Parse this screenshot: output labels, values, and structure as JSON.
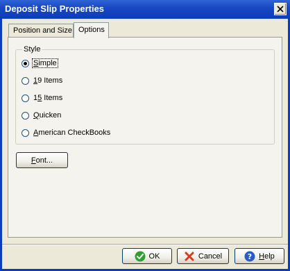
{
  "window": {
    "title": "Deposit Slip Properties"
  },
  "tabs": [
    {
      "label": "Position and Size"
    },
    {
      "label": "Options"
    }
  ],
  "style_group": {
    "legend": "Style",
    "options": [
      {
        "prefix": "",
        "accel": "S",
        "rest": "imple",
        "checked": true
      },
      {
        "prefix": "",
        "accel": "1",
        "rest": "9 Items",
        "checked": false
      },
      {
        "prefix": "1",
        "accel": "5",
        "rest": " Items",
        "checked": false
      },
      {
        "prefix": "",
        "accel": "Q",
        "rest": "uicken",
        "checked": false
      },
      {
        "prefix": "",
        "accel": "A",
        "rest": "merican CheckBooks",
        "checked": false
      }
    ]
  },
  "font_button": {
    "accel": "F",
    "rest": "ont..."
  },
  "buttons": {
    "ok": "OK",
    "cancel": "Cancel",
    "help_accel": "H",
    "help_rest": "elp"
  },
  "colors": {
    "titlebar": "#0b3cb9",
    "ok_icon": "#2fa02f",
    "cancel_icon": "#d83a1a",
    "help_icon": "#2a5bbf"
  }
}
